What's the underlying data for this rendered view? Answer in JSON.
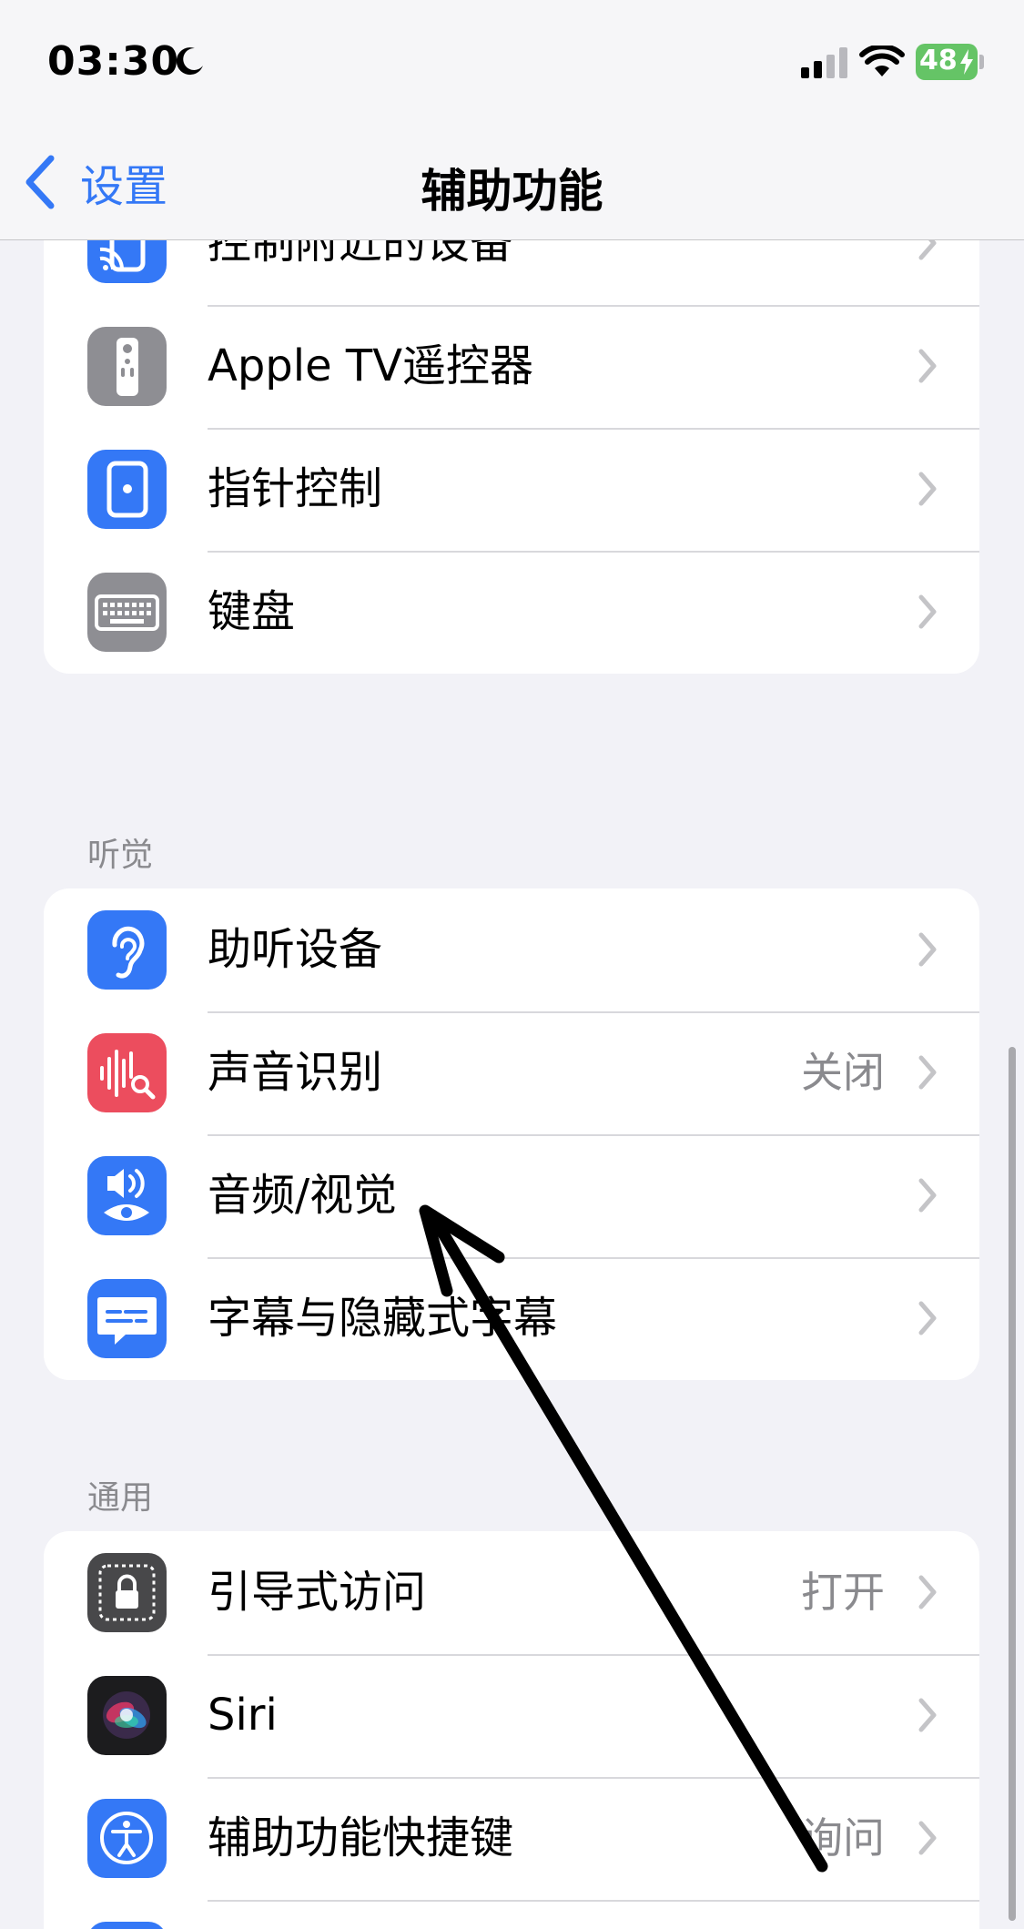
{
  "status_bar": {
    "time": "03:30",
    "battery": "48"
  },
  "nav": {
    "back_label": "设置",
    "title": "辅助功能"
  },
  "groups": {
    "physical": {
      "items": [
        {
          "label": "控制附近的设备",
          "icon": "nearby-devices-icon",
          "icon_color": "#3478f6"
        },
        {
          "label": "Apple TV遥控器",
          "icon": "tv-remote-icon",
          "icon_color": "#8e8e93"
        },
        {
          "label": "指针控制",
          "icon": "pointer-control-icon",
          "icon_color": "#3478f6"
        },
        {
          "label": "键盘",
          "icon": "keyboard-icon",
          "icon_color": "#8e8e93"
        }
      ]
    },
    "hearing": {
      "header": "听觉",
      "items": [
        {
          "label": "助听设备",
          "icon": "ear-icon",
          "icon_color": "#3478f6"
        },
        {
          "label": "声音识别",
          "value": "关闭",
          "icon": "sound-recognition-icon",
          "icon_color": "#ec4d5e"
        },
        {
          "label": "音频/视觉",
          "icon": "audio-visual-icon",
          "icon_color": "#3478f6"
        },
        {
          "label": "字幕与隐藏式字幕",
          "icon": "subtitles-icon",
          "icon_color": "#3478f6"
        }
      ]
    },
    "general": {
      "header": "通用",
      "items": [
        {
          "label": "引导式访问",
          "value": "打开",
          "icon": "guided-access-icon",
          "icon_color": "#48484a"
        },
        {
          "label": "Siri",
          "icon": "siri-icon",
          "icon_color": "#1c1c1e"
        },
        {
          "label": "辅助功能快捷键",
          "value": "询问",
          "icon": "accessibility-icon",
          "icon_color": "#3478f6"
        }
      ]
    }
  },
  "colors": {
    "accent": "#3478f6",
    "battery": "#65c466",
    "annotation": "#000000"
  }
}
